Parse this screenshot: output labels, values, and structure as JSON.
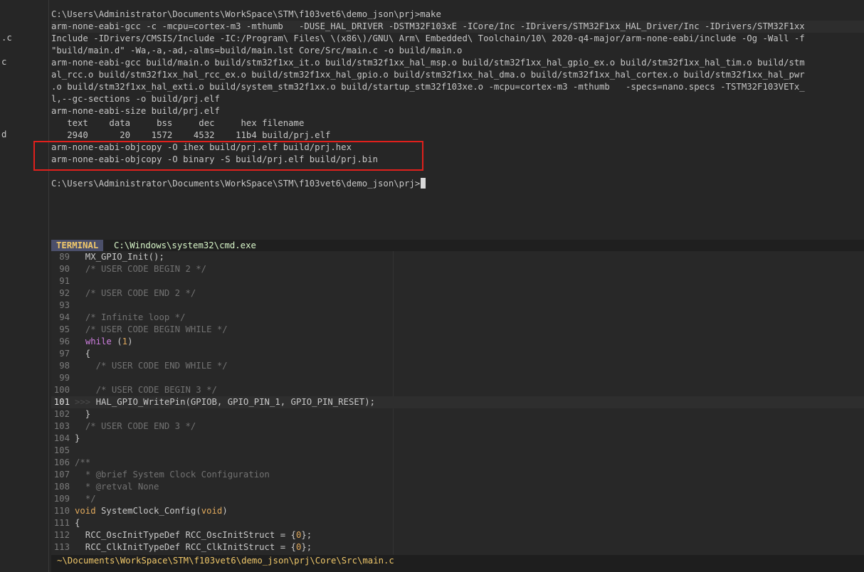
{
  "gutter_fragments": [
    ".c",
    "c",
    "d"
  ],
  "terminal": {
    "lines": [
      "C:\\Users\\Administrator\\Documents\\WorkSpace\\STM\\f103vet6\\demo_json\\prj>make",
      "arm-none-eabi-gcc -c -mcpu=cortex-m3 -mthumb   -DUSE_HAL_DRIVER -DSTM32F103xE -ICore/Inc -IDrivers/STM32F1xx_HAL_Driver/Inc -IDrivers/STM32F1xx",
      "Include -IDrivers/CMSIS/Include -IC:/Program\\ Files\\ \\(x86\\)/GNU\\ Arm\\ Embedded\\ Toolchain/10\\ 2020-q4-major/arm-none-eabi/include -Og -Wall -f",
      "\"build/main.d\" -Wa,-a,-ad,-alms=build/main.lst Core/Src/main.c -o build/main.o",
      "arm-none-eabi-gcc build/main.o build/stm32f1xx_it.o build/stm32f1xx_hal_msp.o build/stm32f1xx_hal_gpio_ex.o build/stm32f1xx_hal_tim.o build/stm",
      "al_rcc.o build/stm32f1xx_hal_rcc_ex.o build/stm32f1xx_hal_gpio.o build/stm32f1xx_hal_dma.o build/stm32f1xx_hal_cortex.o build/stm32f1xx_hal_pwr",
      ".o build/stm32f1xx_hal_exti.o build/system_stm32f1xx.o build/startup_stm32f103xe.o -mcpu=cortex-m3 -mthumb   -specs=nano.specs -TSTM32F103VETx_",
      "l,--gc-sections -o build/prj.elf",
      "arm-none-eabi-size build/prj.elf",
      "   text    data     bss     dec     hex filename",
      "   2940      20    1572    4532    11b4 build/prj.elf",
      "arm-none-eabi-objcopy -O ihex build/prj.elf build/prj.hex",
      "arm-none-eabi-objcopy -O binary -S build/prj.elf build/prj.bin",
      "",
      "C:\\Users\\Administrator\\Documents\\WorkSpace\\STM\\f103vet6\\demo_json\\prj>"
    ]
  },
  "statusbar": {
    "badge": "TERMINAL",
    "title": "C:\\Windows\\system32\\cmd.exe"
  },
  "editor": {
    "lines": [
      {
        "n": "89",
        "t": "  MX_GPIO_Init();"
      },
      {
        "n": "90",
        "t": "  /* USER CODE BEGIN 2 */"
      },
      {
        "n": "91",
        "t": ""
      },
      {
        "n": "92",
        "t": "  /* USER CODE END 2 */"
      },
      {
        "n": "93",
        "t": ""
      },
      {
        "n": "94",
        "t": "  /* Infinite loop */"
      },
      {
        "n": "95",
        "t": "  /* USER CODE BEGIN WHILE */"
      },
      {
        "n": "96",
        "t": "  while (1)"
      },
      {
        "n": "97",
        "t": "  {"
      },
      {
        "n": "98",
        "t": "    /* USER CODE END WHILE */"
      },
      {
        "n": "99",
        "t": ""
      },
      {
        "n": "100",
        "t": "    /* USER CODE BEGIN 3 */"
      },
      {
        "n": "101",
        "t": "    HAL_GPIO_WritePin(GPIOB, GPIO_PIN_1, GPIO_PIN_RESET);"
      },
      {
        "n": "102",
        "t": "  }"
      },
      {
        "n": "103",
        "t": "  /* USER CODE END 3 */"
      },
      {
        "n": "104",
        "t": "}"
      },
      {
        "n": "105",
        "t": ""
      },
      {
        "n": "106",
        "t": "/**"
      },
      {
        "n": "107",
        "t": "  * @brief System Clock Configuration"
      },
      {
        "n": "108",
        "t": "  * @retval None"
      },
      {
        "n": "109",
        "t": "  */"
      },
      {
        "n": "110",
        "t": "void SystemClock_Config(void)"
      },
      {
        "n": "111",
        "t": "{"
      },
      {
        "n": "112",
        "t": "  RCC_OscInitTypeDef RCC_OscInitStruct = {0};"
      },
      {
        "n": "113",
        "t": "  RCC_ClkInitTypeDef RCC_ClkInitStruct = {0};"
      }
    ],
    "current_line": "101"
  },
  "pathbar": {
    "path": "~\\Documents\\WorkSpace\\STM\\f103vet6\\demo_json\\prj\\Core\\Src\\main.c"
  },
  "colors": {
    "highlight_box": "#e0201c",
    "badge_bg": "#4b4f6a",
    "accent_yellow": "#f0c86a",
    "keyword": "#cf7fe0"
  }
}
